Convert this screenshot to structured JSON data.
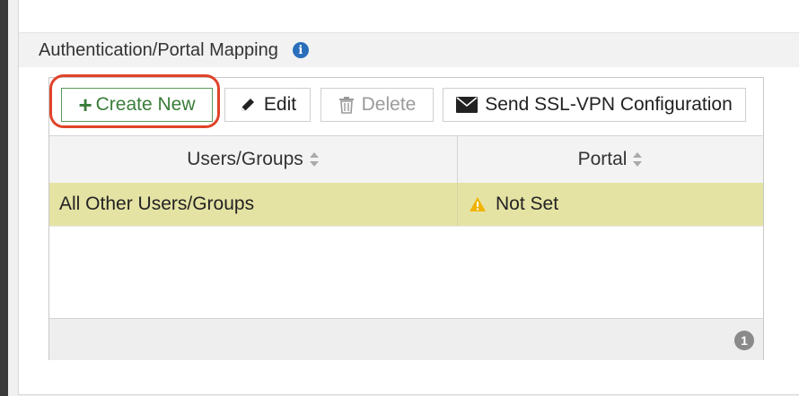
{
  "section": {
    "title": "Authentication/Portal Mapping",
    "info_icon": "info-icon"
  },
  "toolbar": {
    "create_new": "Create New",
    "edit": "Edit",
    "delete": "Delete",
    "send_ssl_vpn": "Send SSL-VPN Configuration"
  },
  "table": {
    "columns": [
      "Users/Groups",
      "Portal"
    ],
    "rows": [
      {
        "users_groups": "All Other Users/Groups",
        "portal": "Not Set",
        "portal_icon": "warning-icon"
      }
    ],
    "row_highlight_color": "#e5e3a4"
  },
  "footer": {
    "page_badge": "1"
  },
  "colors": {
    "create_accent": "#3a7d3a",
    "highlight_ring": "#e0432a",
    "info_blue": "#2a6ebb",
    "warning": "#f0b400"
  }
}
